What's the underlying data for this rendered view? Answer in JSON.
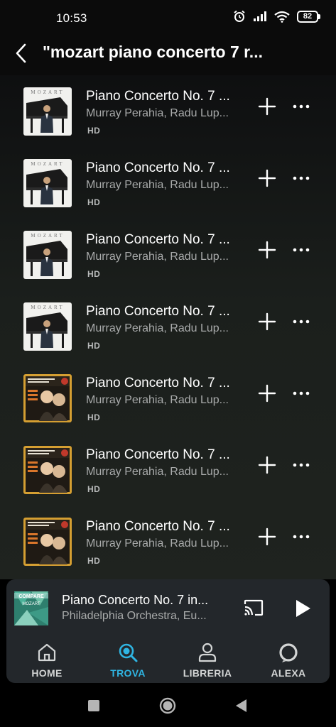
{
  "status_bar": {
    "time": "10:53",
    "battery": "82"
  },
  "header": {
    "title": "\"mozart piano concerto 7 r..."
  },
  "tracks": [
    {
      "title": "Piano Concerto No. 7 ...",
      "artist": "Murray Perahia, Radu Lup...",
      "badge": "HD",
      "art": "mozart-album-cover-white"
    },
    {
      "title": "Piano Concerto No. 7 ...",
      "artist": "Murray Perahia, Radu Lup...",
      "badge": "HD",
      "art": "mozart-album-cover-white"
    },
    {
      "title": "Piano Concerto No. 7 ...",
      "artist": "Murray Perahia, Radu Lup...",
      "badge": "HD",
      "art": "mozart-album-cover-white"
    },
    {
      "title": "Piano Concerto No. 7 ...",
      "artist": "Murray Perahia, Radu Lup...",
      "badge": "HD",
      "art": "mozart-album-cover-white"
    },
    {
      "title": "Piano Concerto No. 7 ...",
      "artist": "Murray Perahia, Radu Lup...",
      "badge": "HD",
      "art": "mozart-concertos-cover-gold"
    },
    {
      "title": "Piano Concerto No. 7 ...",
      "artist": "Murray Perahia, Radu Lup...",
      "badge": "HD",
      "art": "mozart-concertos-cover-gold"
    },
    {
      "title": "Piano Concerto No. 7 ...",
      "artist": "Murray Perahia, Radu Lup...",
      "badge": "HD",
      "art": "mozart-concertos-cover-gold"
    }
  ],
  "now_playing": {
    "title": "Piano Concerto No. 7 in...",
    "artist": "Philadelphia Orchestra, Eu...",
    "art_text": {
      "top": "COMPARE",
      "name": "MOZART"
    }
  },
  "nav": {
    "items": [
      {
        "label": "HOME",
        "icon": "home-icon",
        "active": false
      },
      {
        "label": "TROVA",
        "icon": "search-icon",
        "active": true
      },
      {
        "label": "LIBRERIA",
        "icon": "person-icon",
        "active": false
      },
      {
        "label": "ALEXA",
        "icon": "alexa-ring-icon",
        "active": false
      }
    ]
  },
  "colors": {
    "accent": "#2fb5e3",
    "panel": "#23272b",
    "subtitle": "#a9abab"
  }
}
